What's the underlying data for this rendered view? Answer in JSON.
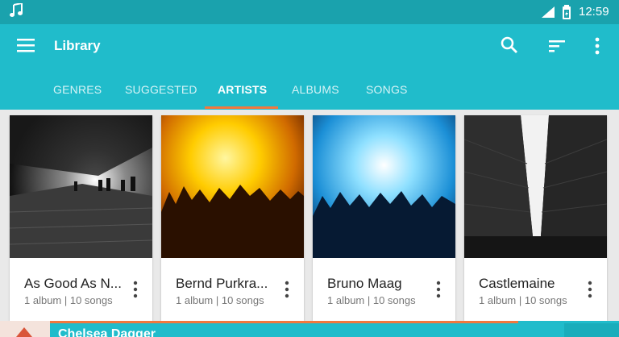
{
  "status_bar": {
    "time": "12:59",
    "icons": [
      "music-note-icon",
      "signal-icon",
      "battery-icon"
    ]
  },
  "app_bar": {
    "title": "Library",
    "actions": [
      "menu-icon",
      "search-icon",
      "sort-icon",
      "more-vert-icon"
    ]
  },
  "tabs": [
    {
      "label": "GENRES",
      "active": false
    },
    {
      "label": "SUGGESTED",
      "active": false
    },
    {
      "label": "ARTISTS",
      "active": true
    },
    {
      "label": "ALBUMS",
      "active": false
    },
    {
      "label": "SONGS",
      "active": false
    }
  ],
  "artists": [
    {
      "name": "As Good As N...",
      "meta": "1 album | 10 songs"
    },
    {
      "name": "Bernd Purkra...",
      "meta": "1 album | 10 songs"
    },
    {
      "name": "Bruno Maag",
      "meta": "1 album | 10 songs"
    },
    {
      "name": "Castlemaine",
      "meta": "1 album | 10 songs"
    }
  ],
  "now_playing": {
    "title": "Chelsea Dagger",
    "progress": 0.91
  },
  "colors": {
    "primary": "#20bccb",
    "status": "#1aa2ad",
    "accent": "#f2783e"
  }
}
